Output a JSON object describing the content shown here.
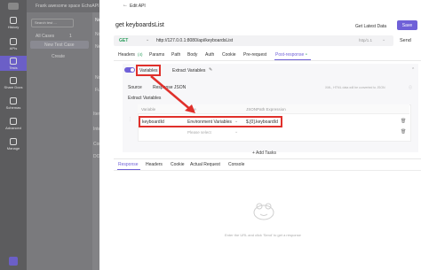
{
  "topbar": {
    "project": "Frank awesome space",
    "breadcrumb": "EchoAPI demo"
  },
  "rail": [
    "History",
    "APIs",
    "Tests",
    "Share Docs",
    "Schemas",
    "Advanced",
    "Manage"
  ],
  "bg_panel": {
    "search": "Search test ...",
    "all_cases": "All Cases",
    "count": "1",
    "new_case": "New Test Case",
    "create": "Create"
  },
  "bg_main": {
    "tab": "New Te",
    "node": "Node",
    "name": "New Tes",
    "no_test": "No Te",
    "func": "Functi",
    "iteration": "Iteration",
    "interval": "Interval",
    "continue": "Continue",
    "do_not": "DO NOT"
  },
  "dialog": {
    "back_label": "Edit API",
    "title": "get keyboardsList",
    "get_latest": "Get Latest Data",
    "save": "Save",
    "method": "GET",
    "url": "http://127.0.0.1:8080/api/keyboardsList",
    "protocol": "http/1.1",
    "send": "Send"
  },
  "req_tabs": {
    "headers": "Headers",
    "headers_badge": "(4)",
    "params": "Params",
    "path": "Path",
    "body": "Body",
    "auth": "Auth",
    "cookie": "Cookie",
    "pre": "Pre-request",
    "post": "Post-response",
    "post_dot": "●"
  },
  "post": {
    "variables": "Variables",
    "extract": "Extract Variables",
    "source_label": "Source",
    "source_value": "Response JSON",
    "hint": "XML, HTML data will be converted to JSON",
    "section": "Extract Variables",
    "col_variable": "Variable",
    "col_type": "Type",
    "col_expr": "JSONPath Expression",
    "row1_var": "keyboardId",
    "row1_type": "Environment Variables",
    "row1_expr": "$.[0].keyboardId",
    "row2_type": "Please select",
    "add_tasks": "+ Add Tasks"
  },
  "resp_tabs": {
    "response": "Response",
    "headers": "Headers",
    "cookie": "Cookie",
    "actual": "Actual Request",
    "console": "Console"
  },
  "empty_hint": "Enter the URL and click 'Send' to get a response",
  "colors": {
    "accent": "#7b6cf6",
    "highlight": "#e0302b",
    "save_bg": "#6f60d8"
  }
}
